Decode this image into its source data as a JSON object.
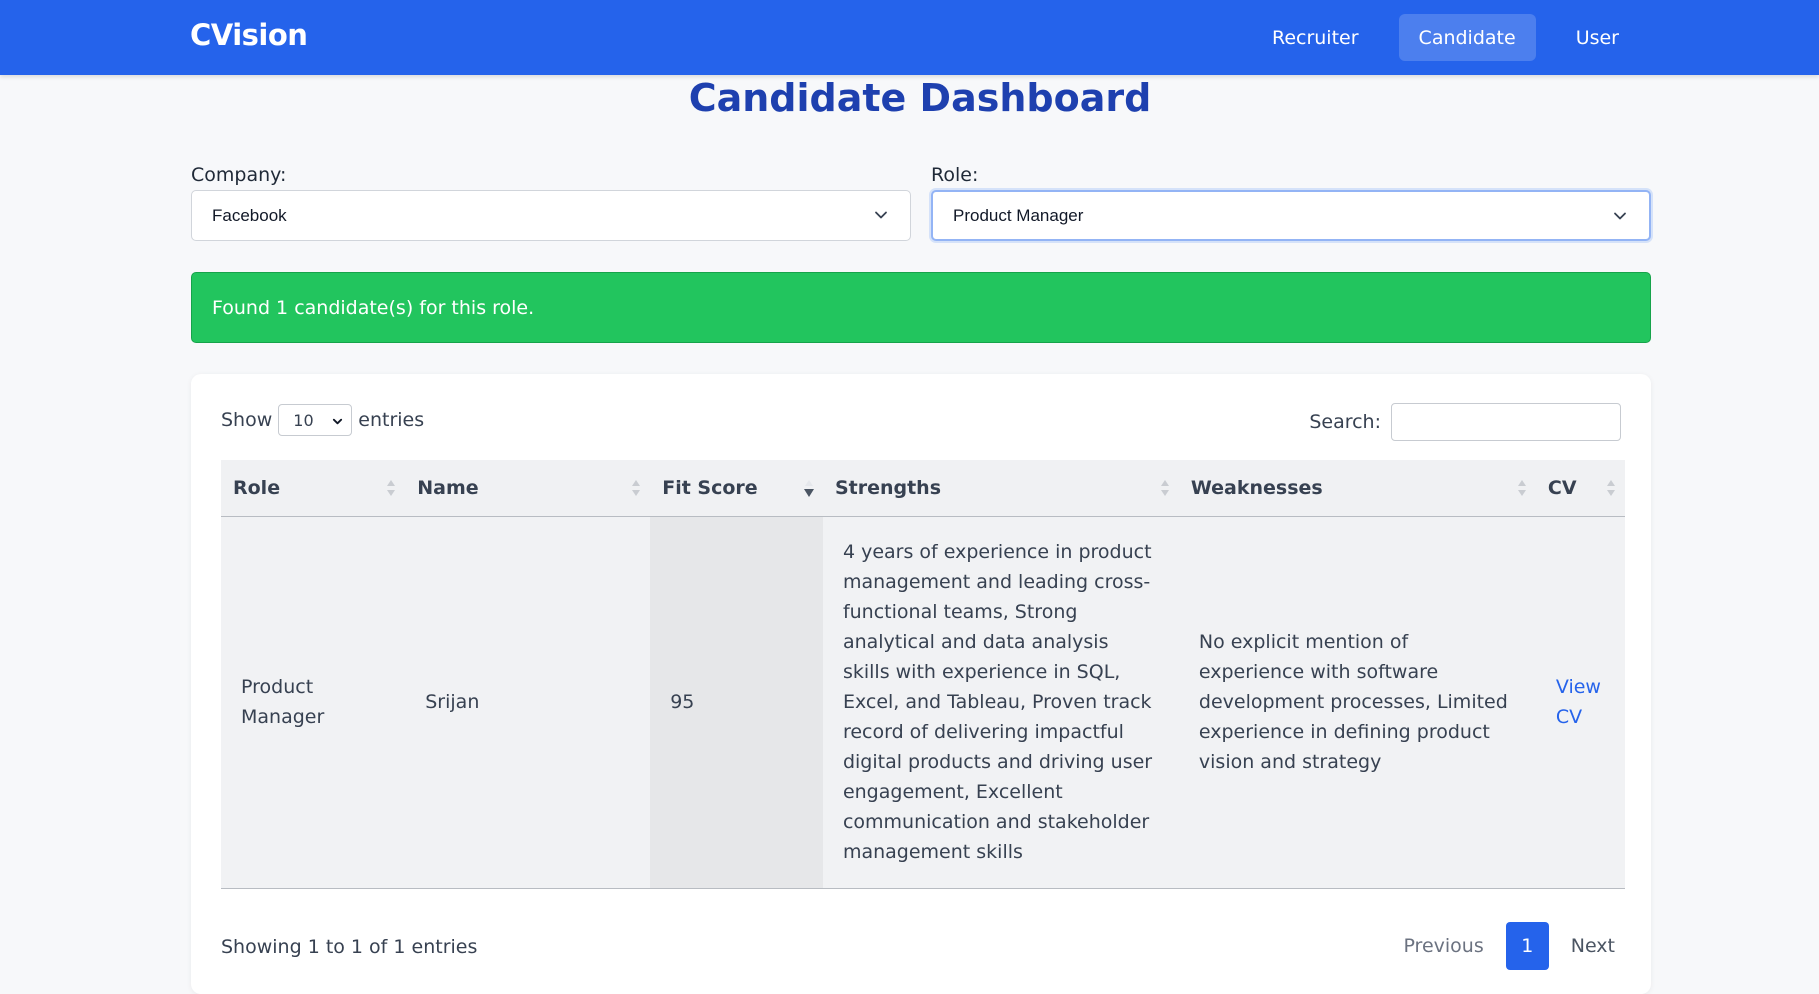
{
  "navbar": {
    "brand": "CVision",
    "links": [
      {
        "label": "Recruiter",
        "active": false
      },
      {
        "label": "Candidate",
        "active": true
      },
      {
        "label": "User",
        "active": false
      }
    ]
  },
  "page": {
    "title": "Candidate Dashboard"
  },
  "filters": {
    "company": {
      "label": "Company:",
      "value": "Facebook"
    },
    "role": {
      "label": "Role:",
      "value": "Product Manager"
    }
  },
  "alert": {
    "text": "Found 1 candidate(s) for this role.",
    "color": "#22c55e"
  },
  "table_controls": {
    "show_label": "Show",
    "entries_value": "10",
    "entries_label": "entries",
    "search_label": "Search:",
    "search_value": ""
  },
  "table": {
    "columns": [
      {
        "label": "Role",
        "sort": "none"
      },
      {
        "label": "Name",
        "sort": "none"
      },
      {
        "label": "Fit Score",
        "sort": "desc"
      },
      {
        "label": "Strengths",
        "sort": "none"
      },
      {
        "label": "Weaknesses",
        "sort": "none"
      },
      {
        "label": "CV",
        "sort": "none"
      }
    ],
    "rows": [
      {
        "role": "Product Manager",
        "name": "Srijan",
        "fit_score": "95",
        "strengths": "4 years of experience in product management and leading cross-functional teams, Strong analytical and data analysis skills with experience in SQL, Excel, and Tableau, Proven track record of delivering impactful digital products and driving user engagement, Excellent communication and stakeholder management skills",
        "weaknesses": "No explicit mention of experience with software development processes, Limited experience in defining product vision and strategy",
        "cv_link": "View CV"
      }
    ]
  },
  "footer": {
    "info": "Showing 1 to 1 of 1 entries",
    "previous": "Previous",
    "current_page": "1",
    "next": "Next"
  },
  "colors": {
    "primary": "#2563eb",
    "title": "#1e40af",
    "success": "#22c55e"
  }
}
